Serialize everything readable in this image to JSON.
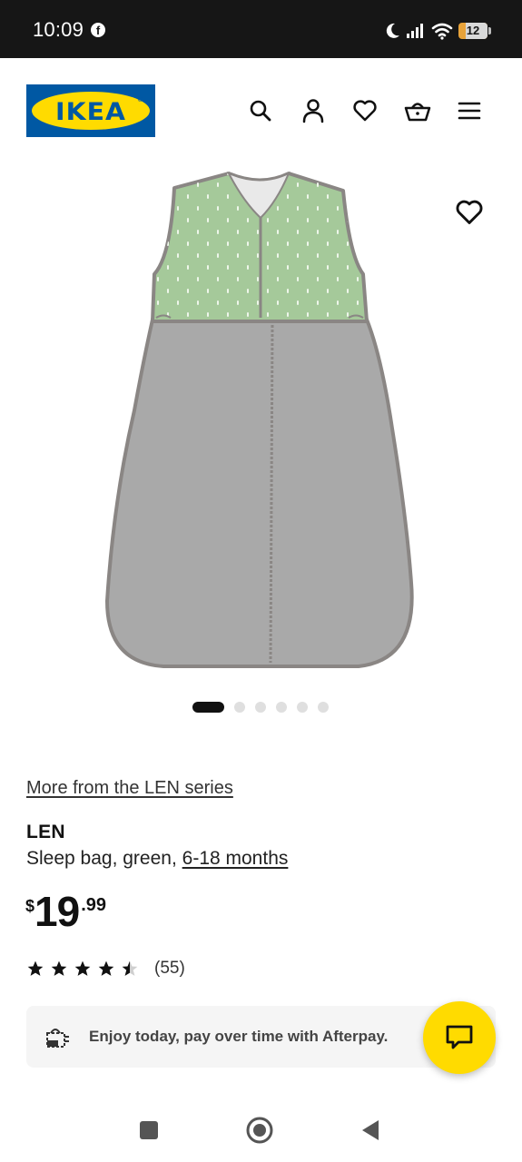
{
  "status_bar": {
    "time": "10:09",
    "notification_icon": "facebook-icon",
    "battery_level": "12",
    "icons": [
      "moon-icon",
      "signal-icon",
      "wifi-icon",
      "battery-icon"
    ]
  },
  "header": {
    "logo_text": "IKEA",
    "logo_registered": "®",
    "icons": [
      "search-icon",
      "account-icon",
      "wishlist-heart-icon",
      "shopping-bag-icon",
      "hamburger-menu-icon"
    ]
  },
  "gallery": {
    "image_name": "LEN sleep bag green",
    "dot_count": 6,
    "active_dot": 0
  },
  "product": {
    "series_link": "More from the LEN series",
    "name": "LEN",
    "description": "Sleep bag, green, ",
    "size_link": "6-18 months",
    "price_currency": "$",
    "price_integer": "19",
    "price_decimal": ".99",
    "rating_value": 4.5,
    "rating_count": "(55)"
  },
  "afterpay": {
    "text": "Enjoy today, pay over time with Afterpay."
  },
  "colors": {
    "ikea_blue": "#0058a3",
    "ikea_yellow": "#ffdb00",
    "bag_green": "#a5c99a",
    "bag_grey": "#a9a9a9"
  }
}
